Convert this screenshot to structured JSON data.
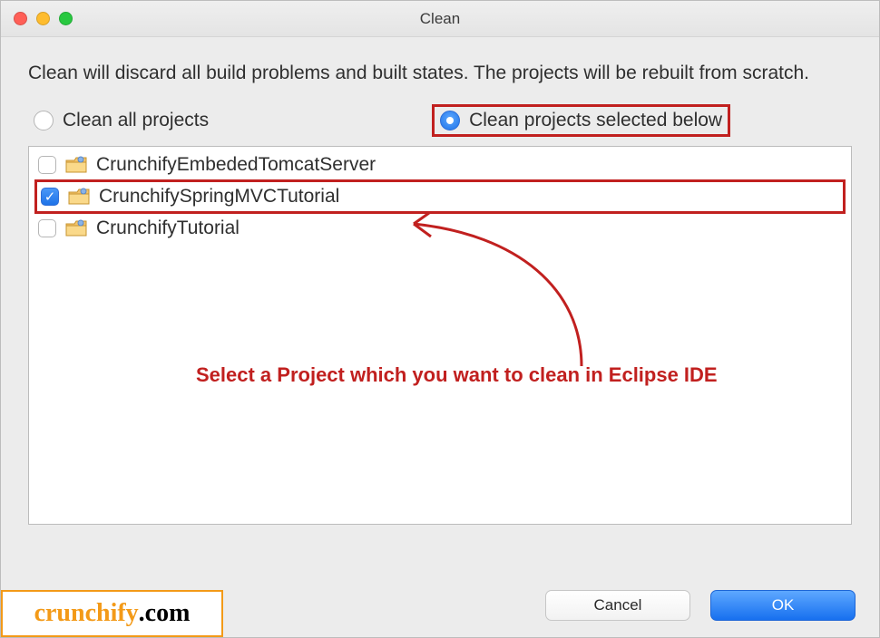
{
  "window": {
    "title": "Clean"
  },
  "description": "Clean will discard all build problems and built states.  The projects will be rebuilt from scratch.",
  "radios": {
    "clean_all": "Clean all projects",
    "clean_selected": "Clean projects selected below"
  },
  "projects": [
    {
      "name": "CrunchifyEmbededTomcatServer",
      "checked": false,
      "highlighted": false
    },
    {
      "name": "CrunchifySpringMVCTutorial",
      "checked": true,
      "highlighted": true
    },
    {
      "name": "CrunchifyTutorial",
      "checked": false,
      "highlighted": false
    }
  ],
  "annotation": {
    "text": "Select a Project which you want to clean in Eclipse IDE"
  },
  "buttons": {
    "cancel": "Cancel",
    "ok": "OK"
  },
  "watermark": {
    "brand": "crunchify",
    "rest": ".com"
  },
  "colors": {
    "annotation_red": "#c1201f",
    "primary_blue": "#1770ef",
    "brand_orange": "#f39a18"
  }
}
